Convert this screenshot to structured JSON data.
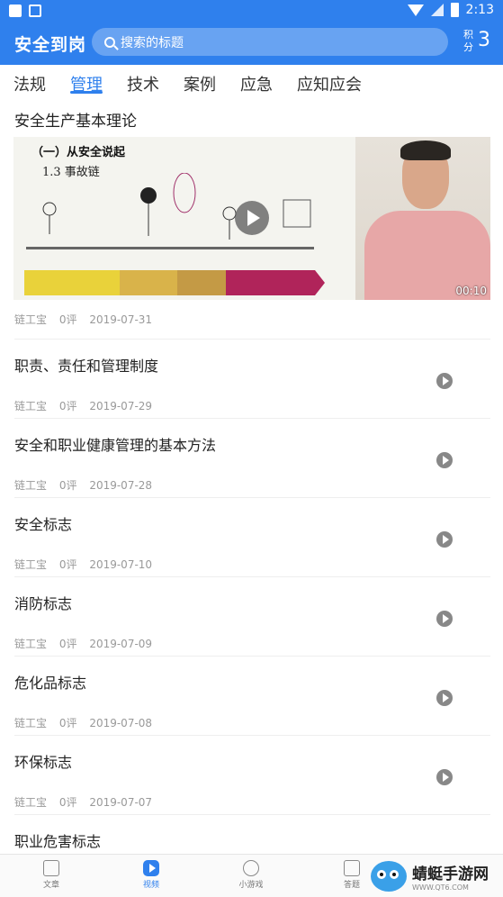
{
  "statusbar": {
    "time": "2:13"
  },
  "appbar": {
    "title": "安全到岗",
    "search_placeholder": "搜索的标题",
    "points_label": "积分",
    "points_value": "3"
  },
  "tabs": [
    {
      "label": "法规"
    },
    {
      "label": "管理"
    },
    {
      "label": "技术"
    },
    {
      "label": "案例"
    },
    {
      "label": "应急"
    },
    {
      "label": "应知应会"
    }
  ],
  "featured": {
    "title": "安全生产基本理论",
    "slide_title": "（一）从安全说起",
    "slide_subtitle": "1.3 事故链",
    "duration": "00:10",
    "author": "链工宝",
    "comments": "0评",
    "date": "2019-07-31"
  },
  "items": [
    {
      "title": "职责、责任和管理制度",
      "author": "链工宝",
      "comments": "0评",
      "date": "2019-07-29"
    },
    {
      "title": "安全和职业健康管理的基本方法",
      "author": "链工宝",
      "comments": "0评",
      "date": "2019-07-28"
    },
    {
      "title": "安全标志",
      "author": "链工宝",
      "comments": "0评",
      "date": "2019-07-10"
    },
    {
      "title": "消防标志",
      "author": "链工宝",
      "comments": "0评",
      "date": "2019-07-09"
    },
    {
      "title": "危化品标志",
      "author": "链工宝",
      "comments": "0评",
      "date": "2019-07-08"
    },
    {
      "title": "环保标志",
      "author": "链工宝",
      "comments": "0评",
      "date": "2019-07-07"
    },
    {
      "title": "职业危害标志"
    }
  ],
  "bottomnav": [
    {
      "label": "文章",
      "icon": "article-icon"
    },
    {
      "label": "视频",
      "icon": "video-icon"
    },
    {
      "label": "小游戏",
      "icon": "gamepad-icon"
    },
    {
      "label": "答题",
      "icon": "quiz-icon"
    }
  ],
  "watermark": {
    "name": "蜻蜓手游网",
    "url": "WWW.QT6.COM"
  },
  "colors": {
    "primary": "#2F80ED",
    "meta_text": "#999999"
  }
}
